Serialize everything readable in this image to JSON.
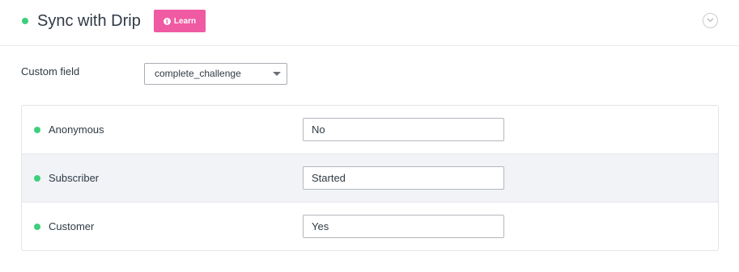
{
  "header": {
    "title": "Sync with Drip",
    "learn_label": "Learn",
    "status_color": "#3ecf7e",
    "learn_color": "#ef5aa2",
    "info_icon": "info-icon",
    "collapse_icon": "chevron-down-circle-icon"
  },
  "custom_field": {
    "label": "Custom field",
    "selected": "complete_challenge"
  },
  "rows": [
    {
      "label": "Anonymous",
      "value": "No"
    },
    {
      "label": "Subscriber",
      "value": "Started"
    },
    {
      "label": "Customer",
      "value": "Yes"
    }
  ]
}
